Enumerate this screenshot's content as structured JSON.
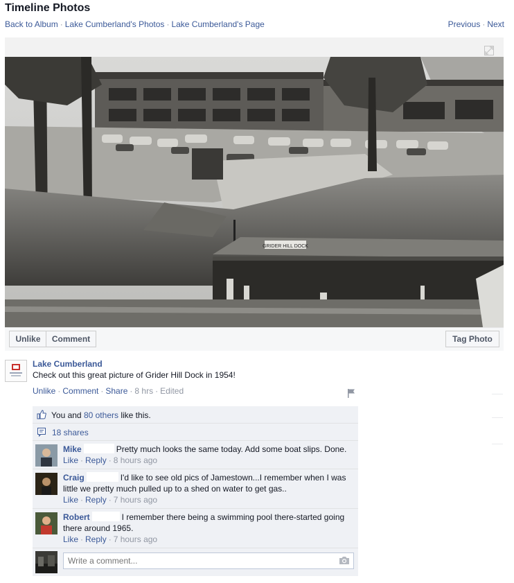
{
  "header": {
    "title": "Timeline Photos",
    "crumbs": [
      "Back to Album",
      "Lake Cumberland's Photos",
      "Lake Cumberland's Page"
    ],
    "prev": "Previous",
    "next": "Next"
  },
  "photo": {
    "sign_text": "GRIDER HILL DOCK"
  },
  "actions": {
    "unlike": "Unlike",
    "comment": "Comment",
    "tag_photo": "Tag Photo"
  },
  "post": {
    "author": "Lake Cumberland",
    "message": "Check out this great picture of Grider Hill Dock in 1954!",
    "unlike": "Unlike",
    "comment": "Comment",
    "share": "Share",
    "time": "8 hrs",
    "edited": "Edited"
  },
  "likes": {
    "prefix": "You and",
    "others_link": "80 others",
    "suffix": "like this."
  },
  "shares": {
    "label": "18 shares"
  },
  "comments": [
    {
      "name": "Mike",
      "text": "Pretty much looks the same today. Add some boat slips. Done.",
      "like": "Like",
      "reply": "Reply",
      "time": "8 hours ago"
    },
    {
      "name": "Craig",
      "text": "I'd like to see old pics of Jamestown...I remember when I was little we pretty much pulled up to a shed on water to get gas..",
      "like": "Like",
      "reply": "Reply",
      "time": "7 hours ago"
    },
    {
      "name": "Robert",
      "text": "I remember there being a swimming pool there-started going there around 1965.",
      "like": "Like",
      "reply": "Reply",
      "time": "7 hours ago"
    }
  ],
  "write_comment": {
    "placeholder": "Write a comment..."
  },
  "icons": {
    "expand": "expand-icon",
    "flag": "flag-icon",
    "thumbs_up": "thumbs-up-icon",
    "share": "share-icon",
    "camera": "camera-icon"
  }
}
